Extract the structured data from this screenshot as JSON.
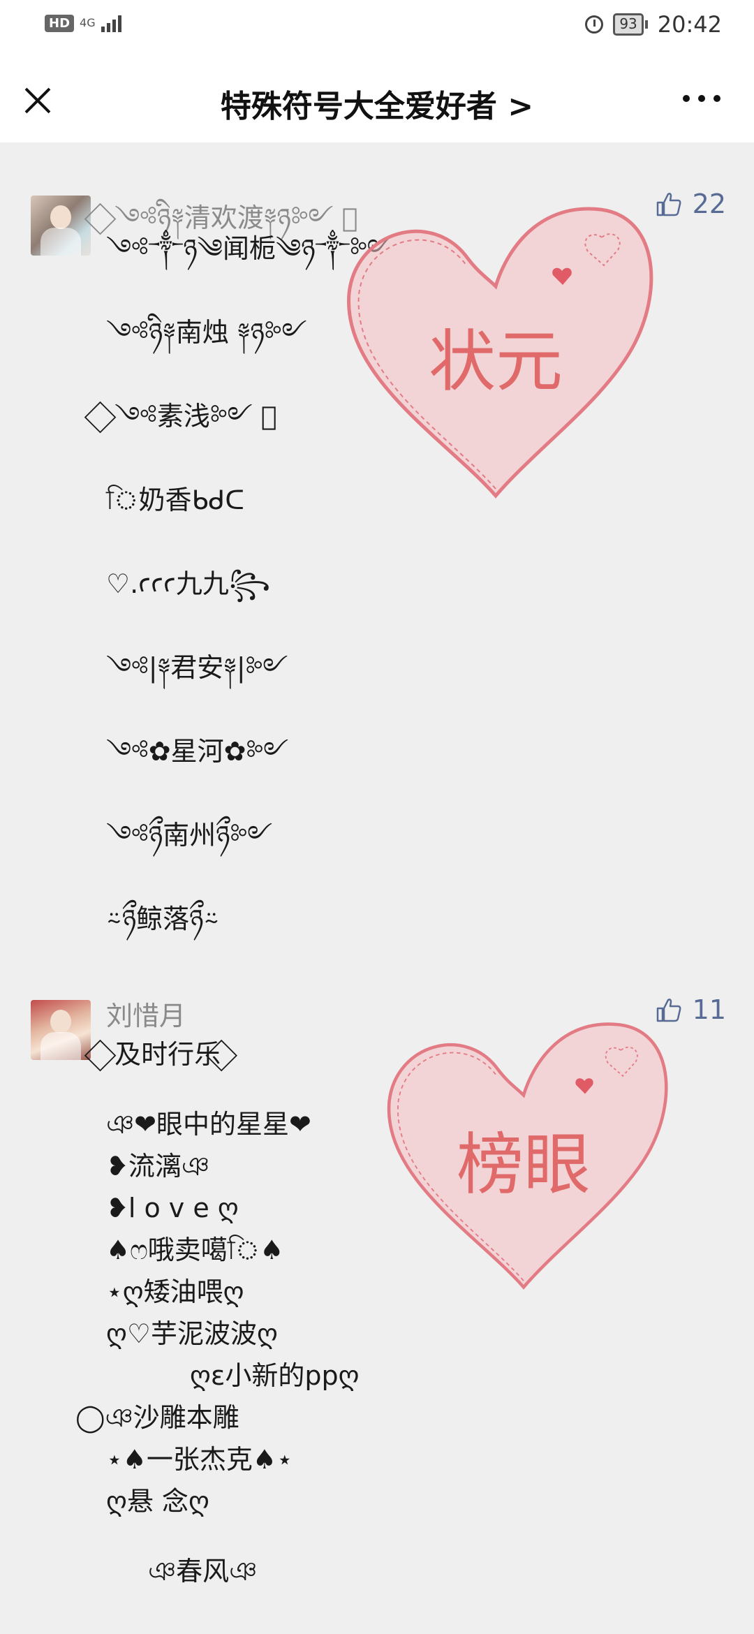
{
  "status_bar": {
    "hd": "HD",
    "network": "4G",
    "battery": "93",
    "time": "20:42"
  },
  "header": {
    "title": "特殊符号大全爱好者 >"
  },
  "comments": [
    {
      "user": "⃟ ༺ཉི༈清欢渡༈ཉ༻ ⃟",
      "likes": "22",
      "stamp": "状元",
      "lines": [
        "༺༒ཉ༄闻栀༄ཉ༒༻",
        "༺ཉི༈南烛 ༈ཉ༻",
        "⃟ ༺素浅༻ ⃟",
        "ি奶香ᑲᑯᑕ",
        "♡.ꜥꜥꜥ九九꧂",
        "༺|༈君安༈|༻",
        "༺✿星河✿༻",
        "༺ཉྀ南州ཉྀ༻",
        "⍨ཉྀ鲸落ཉྀ⍨"
      ]
    },
    {
      "user": "刘惜月",
      "likes": "11",
      "stamp": "榜眼",
      "lines": [
        "⃟ 及时行乐 ⃟",
        "ঞ❤眼中的星星❤",
        "❥流漓ঞ",
        "❥l o v e ღ",
        "♠ෆ哦卖噶ি♠",
        "⋆ღ矮油喂ღ",
        "ღ♡芋泥波波ღ",
        "ღɛ小新的ppღ",
        "◯ঞ沙雕本雕",
        "⋆♠一张杰克♠⋆",
        "ღ悬 念ღ",
        "ঞ春风ঞ"
      ]
    }
  ]
}
